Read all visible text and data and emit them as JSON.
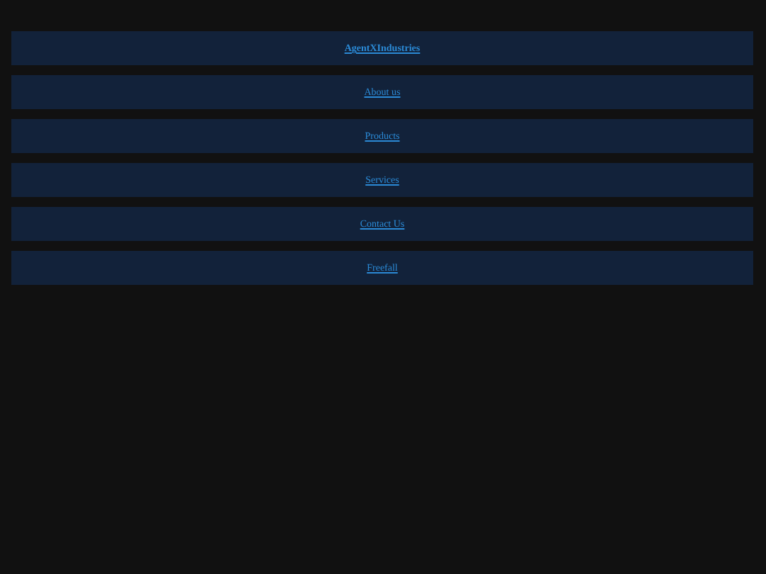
{
  "nav": [
    {
      "label": "AgentXIndustries",
      "kind": "brand"
    },
    {
      "label": "About us",
      "kind": "link"
    },
    {
      "label": "Products",
      "kind": "link"
    },
    {
      "label": "Services",
      "kind": "link"
    },
    {
      "label": "Contact Us",
      "kind": "link"
    },
    {
      "label": "Freefall",
      "kind": "link"
    }
  ]
}
